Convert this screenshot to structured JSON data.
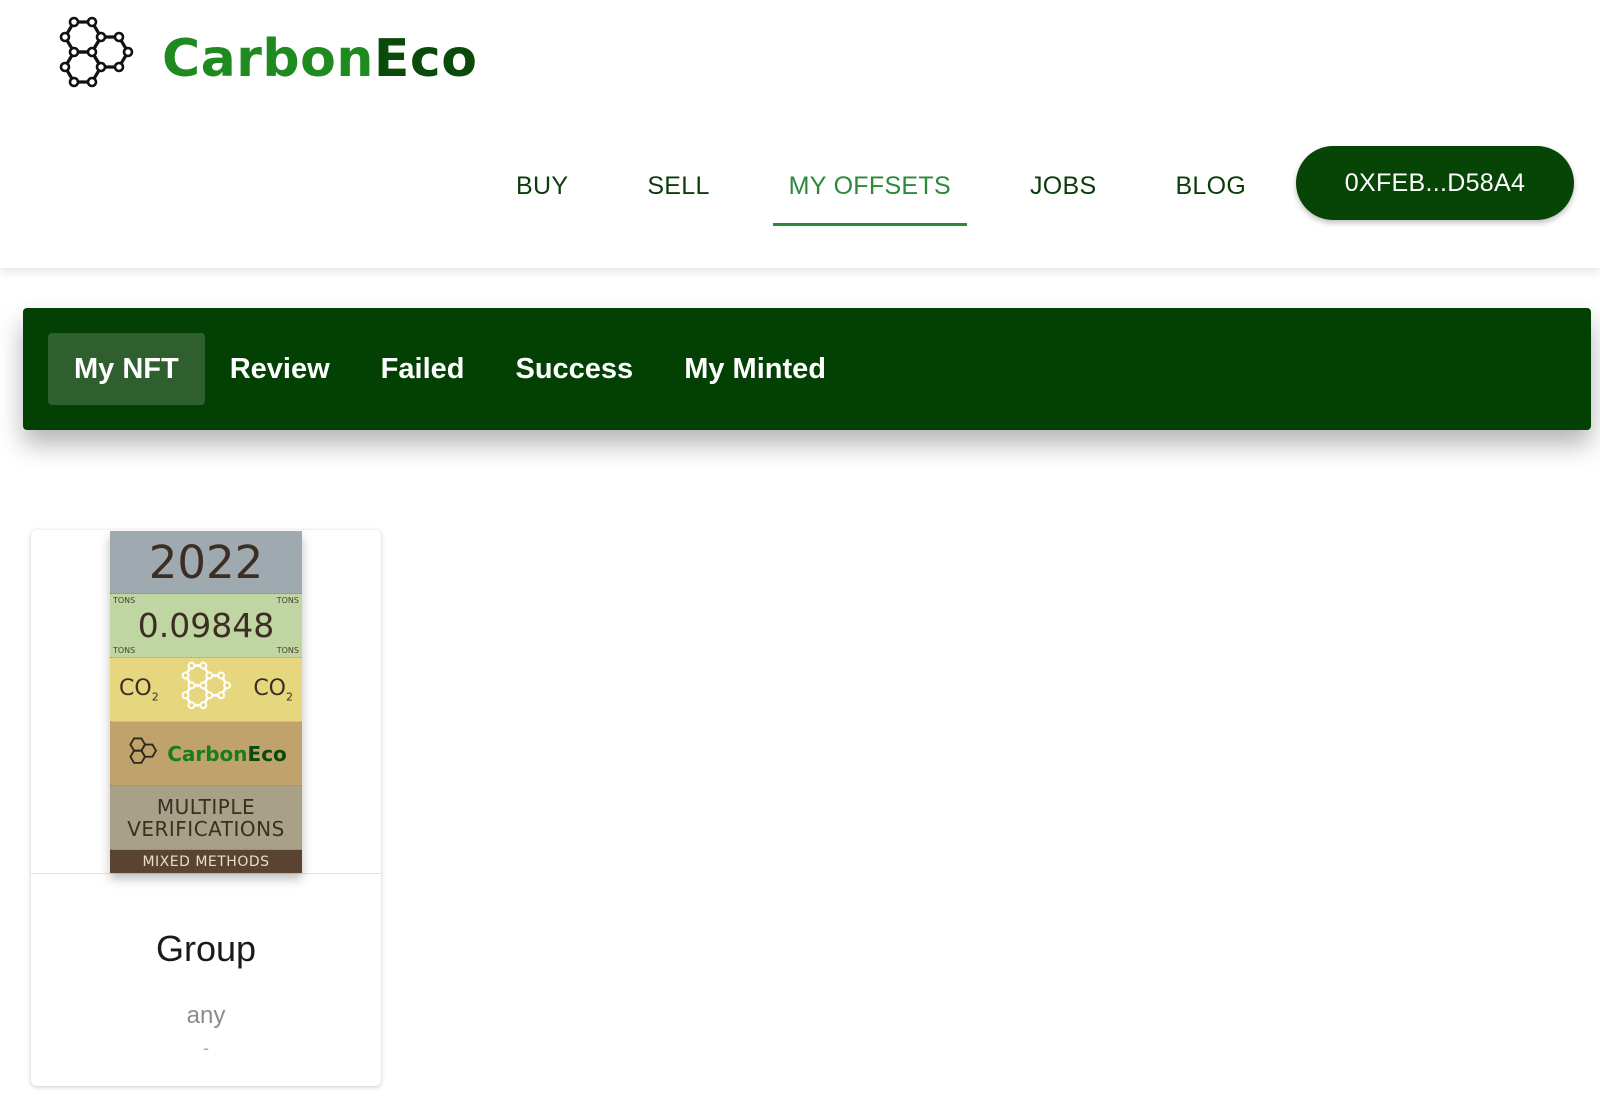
{
  "brand": {
    "name_part1": "Carbon",
    "name_part2": "Eco",
    "icon": "hexagon-molecule-icon"
  },
  "nav": {
    "items": [
      {
        "label": "BUY",
        "active": false
      },
      {
        "label": "SELL",
        "active": false
      },
      {
        "label": "MY OFFSETS",
        "active": true
      },
      {
        "label": "JOBS",
        "active": false
      },
      {
        "label": "BLOG",
        "active": false
      }
    ],
    "wallet_label": "0XFEB...D58A4"
  },
  "tabs": [
    {
      "label": "My NFT",
      "active": true
    },
    {
      "label": "Review",
      "active": false
    },
    {
      "label": "Failed",
      "active": false
    },
    {
      "label": "Success",
      "active": false
    },
    {
      "label": "My Minted",
      "active": false
    }
  ],
  "card": {
    "nft": {
      "year": "2022",
      "tons_label": "TONS",
      "amount": "0.09848",
      "co2_main": "CO",
      "co2_sub": "2",
      "logo_part1": "Carbon",
      "logo_part2": "Eco",
      "verification_line1": "MULTIPLE",
      "verification_line2": "VERIFICATIONS",
      "method": "MIXED METHODS"
    },
    "title": "Group",
    "subtitle": "any",
    "detail": "-"
  },
  "colors": {
    "brand_green": "#1f8a1f",
    "dark_green": "#034003",
    "active_nav": "#2a8a3a",
    "wallet_bg": "#074507"
  }
}
